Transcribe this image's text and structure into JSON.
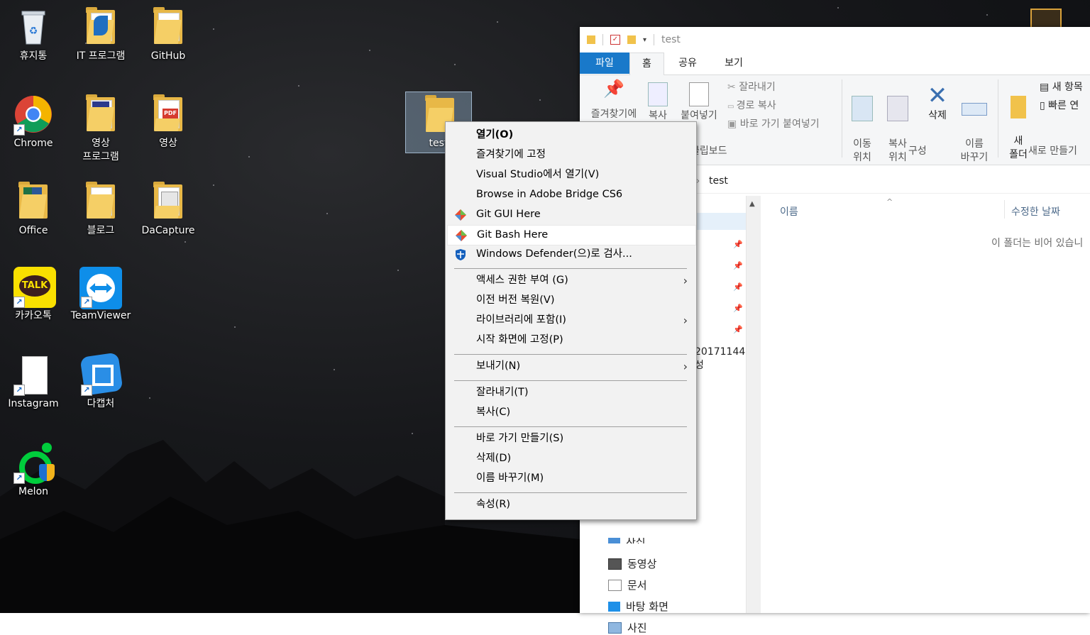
{
  "desktop": {
    "icons": [
      {
        "label": "휴지통"
      },
      {
        "label": "IT 프로그램"
      },
      {
        "label": "GitHub"
      },
      {
        "label": "Chrome"
      },
      {
        "label": "영상\n프로그램"
      },
      {
        "label": "영상"
      },
      {
        "label": "Office"
      },
      {
        "label": "블로그"
      },
      {
        "label": "DaCapture"
      },
      {
        "label": "카카오톡"
      },
      {
        "label": "TeamViewer"
      },
      {
        "label": "Instagram"
      },
      {
        "label": "다캡처"
      },
      {
        "label": "Melon"
      },
      {
        "label": "test"
      }
    ],
    "kakao_badge": "TALK"
  },
  "explorer": {
    "title": "test",
    "tabs": [
      "파일",
      "홈",
      "공유",
      "보기"
    ],
    "ribbon": {
      "pin": "즐겨찾기에",
      "copy": "복사",
      "paste": "붙여넣기",
      "cut": "잘라내기",
      "copy_path": "경로 복사",
      "paste_shortcut": "바로 가기 붙여넣기",
      "move_to": "이동\n위치",
      "copy_to": "복사\n위치",
      "delete": "삭제",
      "rename": "이름\n바꾸기",
      "new_folder": "새\n폴더",
      "new_item": "새 항목",
      "easy_access": "빠른 연",
      "group_clipboard": "클립보드",
      "group_organize": "구성",
      "group_new": "새로 만들기"
    },
    "address": "test",
    "columns": {
      "name": "이름",
      "modified": "수정한 날짜"
    },
    "empty_message": "이 폴더는 비어 있습니",
    "nav_fragment": "20171144 성",
    "nav_items": [
      "사진",
      "동영상",
      "문서",
      "바탕 화면",
      "사진"
    ]
  },
  "context_menu": {
    "items": [
      {
        "label": "열기(O)"
      },
      {
        "label": "즐겨찾기에 고정"
      },
      {
        "label": "Visual Studio에서 열기(V)"
      },
      {
        "label": "Browse in Adobe Bridge CS6"
      },
      {
        "label": "Git GUI Here"
      },
      {
        "label": "Git Bash Here"
      },
      {
        "label": "Windows Defender(으)로 검사..."
      },
      {
        "label": "액세스 권한 부여 (G)"
      },
      {
        "label": "이전 버전 복원(V)"
      },
      {
        "label": "라이브러리에 포함(I)"
      },
      {
        "label": "시작 화면에 고정(P)"
      },
      {
        "label": "보내기(N)"
      },
      {
        "label": "잘라내기(T)"
      },
      {
        "label": "복사(C)"
      },
      {
        "label": "바로 가기 만들기(S)"
      },
      {
        "label": "삭제(D)"
      },
      {
        "label": "이름 바꾸기(M)"
      },
      {
        "label": "속성(R)"
      }
    ],
    "highlight_color": "#ffffff",
    "accent": "#1979ca"
  }
}
